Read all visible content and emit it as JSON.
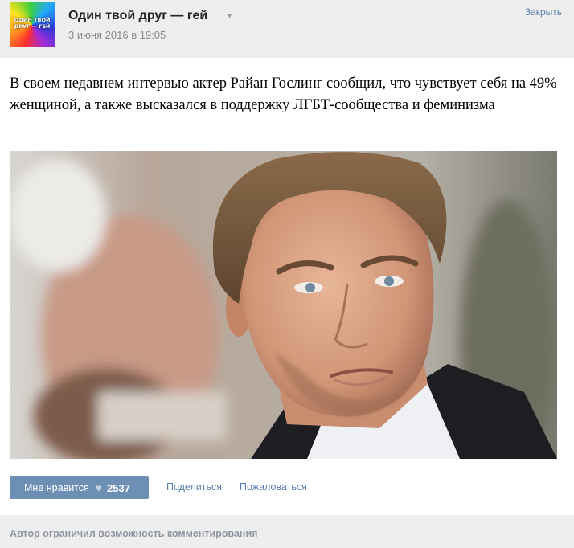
{
  "header": {
    "avatar_text": "ОДИН ТВОЙ\nДРУГ — ГЕЙ",
    "group_name": "Один твой друг — гей",
    "caret": "▾",
    "date": "3 июня 2016 в 19:05",
    "close_label": "Закрыть"
  },
  "post": {
    "text": "В своем недавнем интервью актер Райан Гослинг сообщил, что чувствует себя на 49% женщиной, а также высказался в поддержку ЛГБТ-сообщества и феминизма"
  },
  "actions": {
    "like_label": "Мне нравится",
    "heart_icon": "♥",
    "like_count": "2537",
    "share_label": "Поделиться",
    "report_label": "Пожаловаться"
  },
  "comments": {
    "notice": "Автор ограничил возможность комментирования"
  },
  "colors": {
    "header_bg": "#eeeeee",
    "link": "#5a7fae",
    "like_button": "#6d8fb3"
  }
}
